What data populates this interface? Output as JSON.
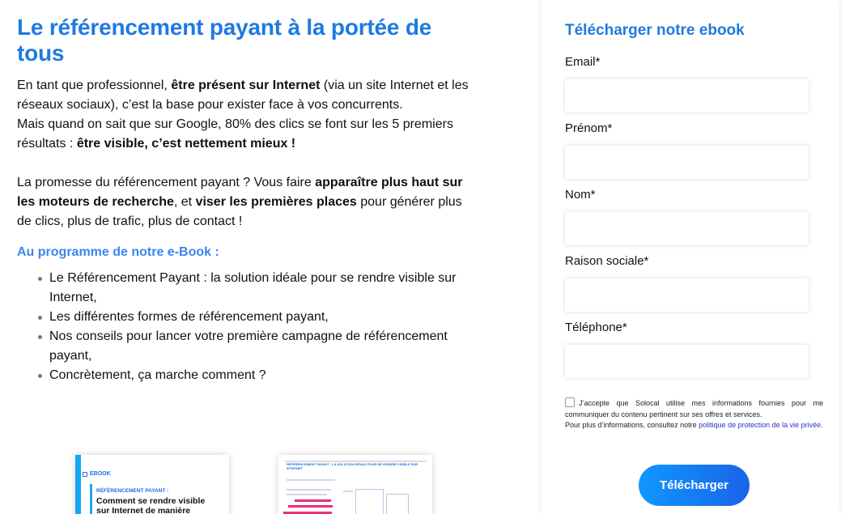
{
  "main": {
    "title": "Le référencement payant à la portée de tous",
    "p1": {
      "a": "En tant que professionnel, ",
      "b": "être présent sur Internet",
      "c": " (via un site Internet et les réseaux sociaux), c’est la base pour exister face à vos concurrents.",
      "d": "Mais quand on sait que sur Google, 80% des clics se font sur les 5 premiers résultats : ",
      "e": "être visible, c’est nettement mieux !"
    },
    "p2": {
      "a": "La promesse du référencement payant ? Vous faire ",
      "b": "apparaître plus haut sur les moteurs de recherche",
      "c": ", et ",
      "d": "viser les premières places",
      "e": " pour générer plus de clics, plus de trafic, plus de contact !"
    },
    "program_heading": "Au programme de notre e-Book :",
    "program_items": [
      "Le Référencement Payant : la solution idéale pour se rendre visible sur Internet,",
      "Les différentes formes de référencement payant,",
      "Nos conseils pour lancer votre première campagne de référencement payant,",
      "Concrètement, ça marche comment ?"
    ],
    "ebook_cover": {
      "tag": "EBOOK",
      "kicker": "RÉFÉRENCEMENT PAYANT :",
      "heading": "Comment se rendre visible sur Internet de manière"
    },
    "ebook_page": {
      "kicker": "RÉFÉRENCEMENT PAYANT - LA SOLUTION IDÉALE POUR SE RENDRE VISIBLE SUR INTERNET"
    }
  },
  "form": {
    "title": "Télécharger notre ebook",
    "fields": {
      "email": {
        "label": "Email*",
        "value": ""
      },
      "prenom": {
        "label": "Prénom*",
        "value": ""
      },
      "nom": {
        "label": "Nom*",
        "value": ""
      },
      "raison": {
        "label": "Raison sociale*",
        "value": ""
      },
      "telephone": {
        "label": "Téléphone*",
        "value": ""
      }
    },
    "consent": {
      "line1": "J’accepte que Solocal utilise mes informations fournies pour me communiquer du contenu pertinent sur ses offres et services.",
      "line2": "Pour plus d’informations, consultez notre ",
      "link": "politique de protection de la vie privée",
      "end": "."
    },
    "submit_label": "Télécharger"
  },
  "colors": {
    "accent": "#1f7ae0",
    "button_start": "#0f98ff",
    "button_end": "#1a63e8"
  }
}
